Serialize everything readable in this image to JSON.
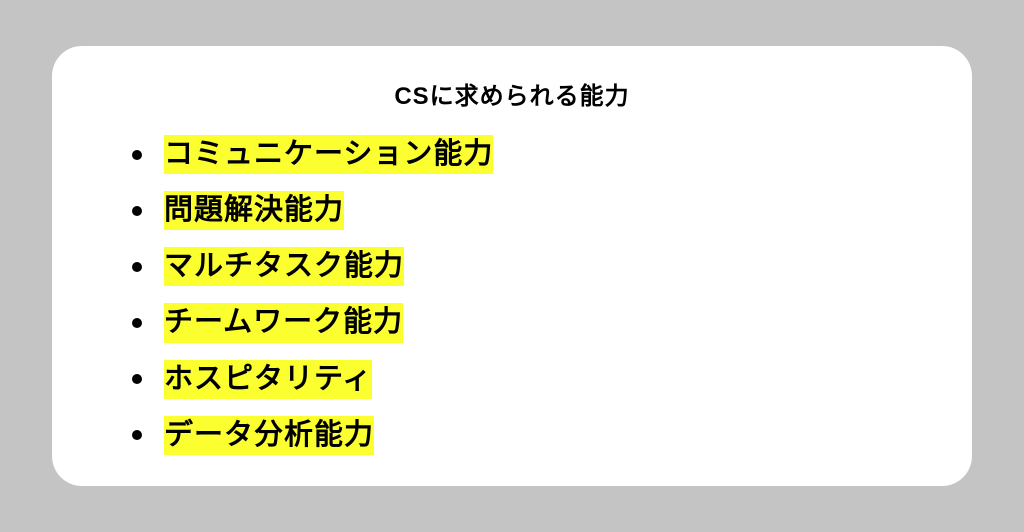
{
  "title": "CSに求められる能力",
  "items": [
    "コミュニケーション能力",
    "問題解決能力",
    "マルチタスク能力",
    "チームワーク能力",
    "ホスピタリティ",
    "データ分析能力"
  ]
}
